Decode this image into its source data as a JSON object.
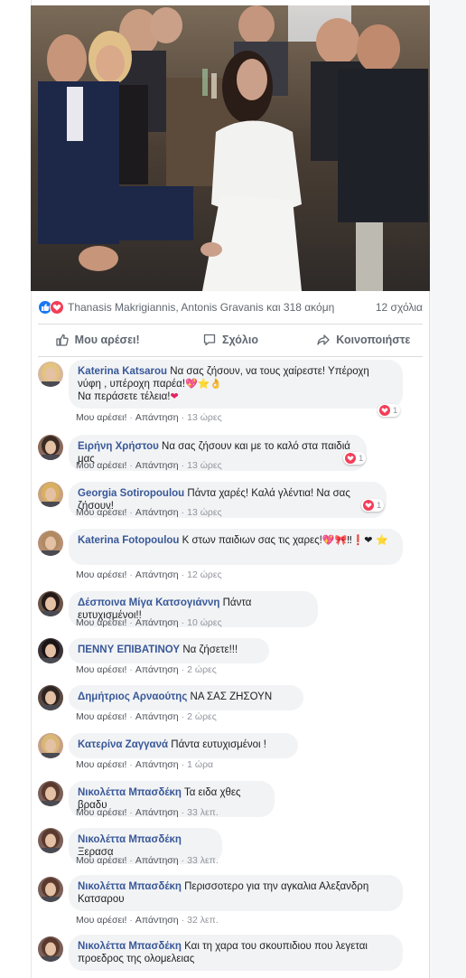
{
  "post": {
    "reactions_text": "Thanasis Makrigiannis, Antonis Gravanis και 318 ακόμη",
    "comments_count": "12 σχόλια"
  },
  "actions": {
    "like": "Μου αρέσει!",
    "comment": "Σχόλιο",
    "share": "Κοινοποιήστε"
  },
  "comment_actions": {
    "like": "Μου αρέσει!",
    "reply": "Απάντηση",
    "sep": "·"
  },
  "comments": [
    {
      "author": "Katerina Katsarou",
      "text": "Να σας ζήσουν, να τους χαίρεστε! Υπέροχη νύφη , υπέροχη παρέα!",
      "line2": "Να περάσετε τέλεια!",
      "time": "13 ώρες",
      "reactions": "1"
    },
    {
      "author": "Ειρήνη Χρήστου",
      "text": "Να σας ζήσουν και με το καλό στα παιδιά μας",
      "time": "13 ώρες",
      "reactions": "1"
    },
    {
      "author": "Georgia Sotiropoulou",
      "text": "Πάντα χαρές! Καλά γλέντια! Να σας ζήσουν!",
      "time": "13 ώρες",
      "reactions": "1"
    },
    {
      "author": "Katerina Fotopoulou",
      "text": "Κ στων παιδιων σας τις χαρες!",
      "time": "12 ώρες"
    },
    {
      "author": "Δέσποινα Μίγα Κατσογιάννη",
      "text": "Πάντα ευτυχισμένοι!!",
      "time": "10 ώρες"
    },
    {
      "author": "ΠΕΝΝΥ ΕΠΙΒΑΤΙΝΟΥ",
      "text": "Να ζήσετε!!!",
      "time": "2 ώρες"
    },
    {
      "author": "Δημήτριος Αρναούτης",
      "text": "ΝΑ ΣΑΣ ΖΗΣΟΥΝ",
      "time": "2 ώρες"
    },
    {
      "author": "Κατερίνα Ζαγγανά",
      "text": "Πάντα ευτυχισμένοι !",
      "time": "1 ώρα"
    },
    {
      "author": "Νικολέττα Μπασδέκη",
      "text": "Τα ειδα χθες βραδυ",
      "time": "33 λεπ."
    },
    {
      "author": "Νικολέττα Μπασδέκη",
      "text": "Ξερασα",
      "time": "33 λεπ."
    },
    {
      "author": "Νικολέττα Μπασδέκη",
      "text": "Περισσοτερο για την αγκαλια Αλεξανδρη",
      "line2": "Κατσαρου",
      "time": "32 λεπ."
    },
    {
      "author": "Νικολέττα Μπασδέκη",
      "text": "Και τη χαρα του σκουπιδιου που λεγεται",
      "line2": "προεδρος της ολομελειας"
    }
  ],
  "colors": {
    "link": "#385898",
    "bubble": "#f2f3f5",
    "like_blue": "#1877f2",
    "love_red": "#f33e58"
  },
  "icons": [
    "like-icon",
    "love-icon",
    "thumbs-up-icon",
    "comment-icon",
    "share-icon",
    "heart-icon"
  ]
}
